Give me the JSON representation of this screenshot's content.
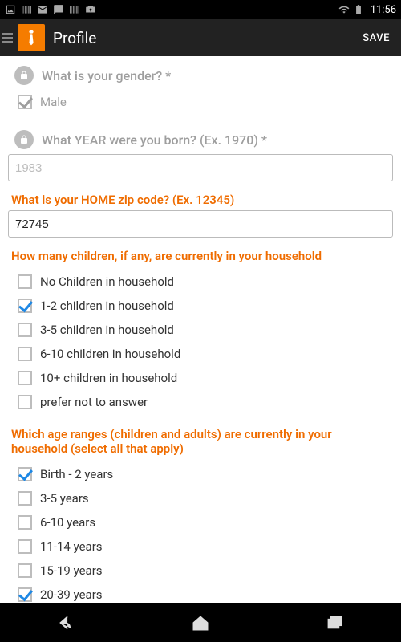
{
  "status": {
    "time": "11:56"
  },
  "header": {
    "title": "Profile",
    "save": "SAVE"
  },
  "q_gender": {
    "label": "What is your gender? *",
    "answer": "Male"
  },
  "q_year": {
    "label": "What YEAR were you born? (Ex. 1970) *",
    "value": "1983"
  },
  "q_zip": {
    "label": "What is your HOME zip code? (Ex. 12345)",
    "value": "72745"
  },
  "q_children": {
    "label": "How many children, if any, are currently in your household",
    "options": [
      {
        "label": "No Children in household",
        "checked": false
      },
      {
        "label": "1-2 children in household",
        "checked": true
      },
      {
        "label": "3-5 children in household",
        "checked": false
      },
      {
        "label": "6-10 children in household",
        "checked": false
      },
      {
        "label": "10+ children in household",
        "checked": false
      },
      {
        "label": "prefer not to answer",
        "checked": false
      }
    ]
  },
  "q_ages": {
    "label": "Which age ranges (children and adults) are currently in your household (select all that apply)",
    "options": [
      {
        "label": "Birth - 2 years",
        "checked": true
      },
      {
        "label": "3-5 years",
        "checked": false
      },
      {
        "label": "6-10 years",
        "checked": false
      },
      {
        "label": "11-14 years",
        "checked": false
      },
      {
        "label": "15-19 years",
        "checked": false
      },
      {
        "label": "20-39 years",
        "checked": true
      }
    ]
  }
}
